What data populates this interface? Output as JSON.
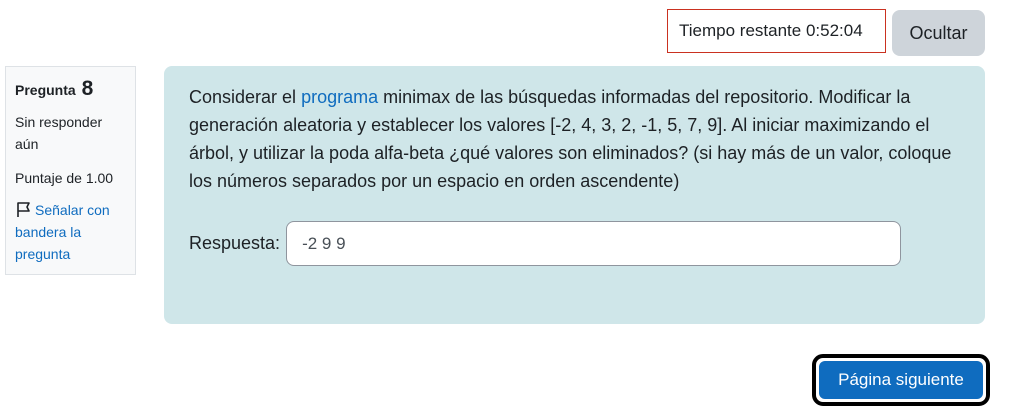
{
  "timer": {
    "label": "Tiempo restante",
    "value": "0:52:04"
  },
  "hide_button_label": "Ocultar",
  "question_info": {
    "title_prefix": "Pregunta",
    "number": "8",
    "state": "Sin responder aún",
    "grade": "Puntaje de 1.00",
    "flag_link_label": "Señalar con bandera la pregunta"
  },
  "question": {
    "text_before_link": "Considerar el ",
    "link_text": "programa",
    "text_after_link": " minimax de las búsquedas informadas del repositorio. Modificar la generación aleatoria y establecer los valores [-2, 4, 3, 2, -1, 5, 7, 9]. Al iniciar maximizando el árbol, y utilizar la poda alfa-beta ¿qué valores son eliminados? (si hay más de un valor, coloque los números separados por un espacio en orden ascendente)",
    "answer_label": "Respuesta:",
    "answer_value": "-2 9 9"
  },
  "next_button_label": "Página siguiente",
  "colors": {
    "accent": "#0f6cbf",
    "content_bg": "#cfe6e9",
    "timer_border": "#ca3120",
    "secondary_button": "#ced4da"
  },
  "icons": {
    "flag": "flag-icon"
  }
}
